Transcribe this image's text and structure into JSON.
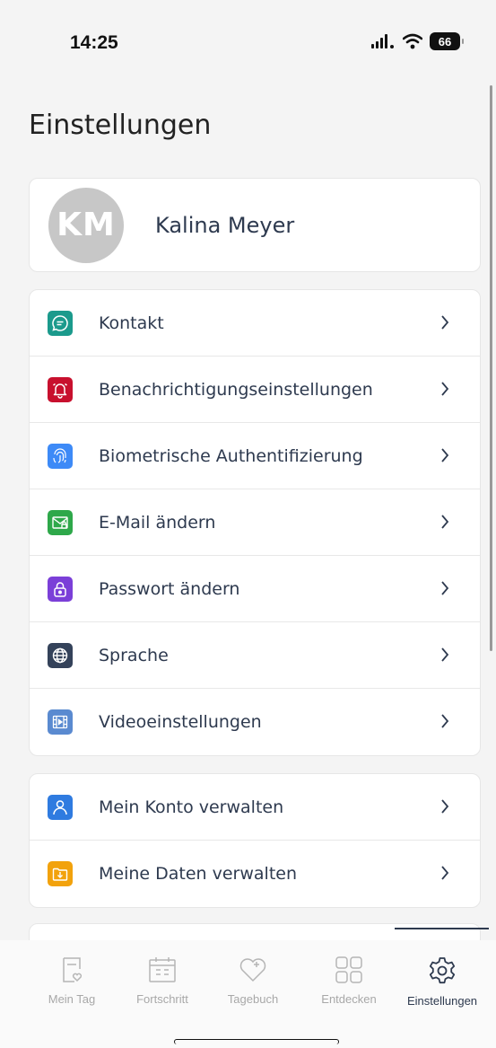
{
  "status_bar": {
    "time": "14:25",
    "battery": "66",
    "icons": [
      "signal-icon",
      "wifi-icon",
      "battery-icon"
    ]
  },
  "page": {
    "title": "Einstellungen"
  },
  "profile": {
    "initials": "KM",
    "name": "Kalina Meyer"
  },
  "settings_group_1": {
    "items": [
      {
        "label": "Kontakt",
        "icon": "chat-icon",
        "color": "#1b9a8c"
      },
      {
        "label": "Benachrichtigungseinstellungen",
        "icon": "bell-icon",
        "color": "#c8102e"
      },
      {
        "label": "Biometrische Authentifizierung",
        "icon": "fingerprint-icon",
        "color": "#3d8af7"
      },
      {
        "label": "E-Mail ändern",
        "icon": "mail-lock-icon",
        "color": "#2ea84a"
      },
      {
        "label": "Passwort ändern",
        "icon": "lock-icon",
        "color": "#7b3fd8"
      },
      {
        "label": "Sprache",
        "icon": "globe-icon",
        "color": "#34425a"
      },
      {
        "label": "Videoeinstellungen",
        "icon": "film-icon",
        "color": "#5a8ad0"
      }
    ]
  },
  "settings_group_2": {
    "items": [
      {
        "label": "Mein Konto verwalten",
        "icon": "user-icon",
        "color": "#2f7be0"
      },
      {
        "label": "Meine Daten verwalten",
        "icon": "folder-download-icon",
        "color": "#f2a20c"
      }
    ]
  },
  "bottom_nav": {
    "items": [
      {
        "label": "Mein Tag",
        "icon": "page-heart-icon"
      },
      {
        "label": "Fortschritt",
        "icon": "calendar-icon"
      },
      {
        "label": "Tagebuch",
        "icon": "heart-plus-icon"
      },
      {
        "label": "Entdecken",
        "icon": "grid-icon"
      },
      {
        "label": "Einstellungen",
        "icon": "gear-icon",
        "active": true
      }
    ]
  }
}
